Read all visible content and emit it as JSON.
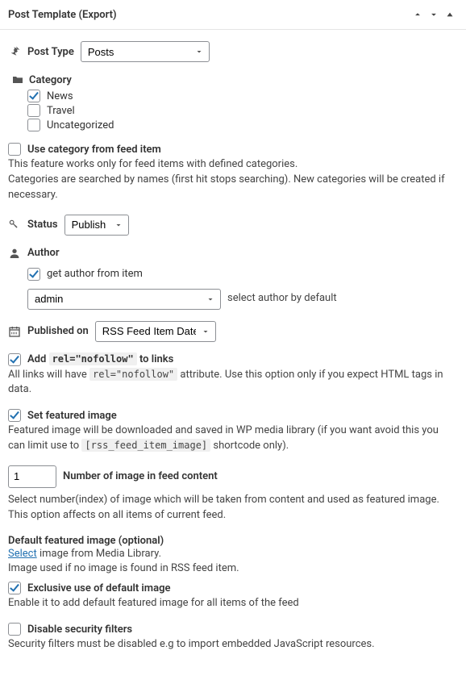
{
  "header": {
    "title": "Post Template (Export)"
  },
  "postType": {
    "label": "Post Type",
    "value": "Posts"
  },
  "category": {
    "label": "Category",
    "items": [
      {
        "label": "News",
        "checked": true
      },
      {
        "label": "Travel",
        "checked": false
      },
      {
        "label": "Uncategorized",
        "checked": false
      }
    ]
  },
  "useCatFromFeed": {
    "label": "Use category from feed item",
    "checked": false,
    "desc1": "This feature works only for feed items with defined categories.",
    "desc2": "Categories are searched by names (first hit stops searching). New categories will be created if necessary."
  },
  "status": {
    "label": "Status",
    "value": "Publish"
  },
  "author": {
    "label": "Author",
    "getFromItem": {
      "label": "get author from item",
      "checked": true
    },
    "value": "admin",
    "defaultHint": "select author by default"
  },
  "publishedOn": {
    "label": "Published on",
    "value": "RSS Feed Item Date"
  },
  "nofollow": {
    "checked": true,
    "pre": "Add",
    "code": "rel=\"nofollow\"",
    "post": "to links",
    "descPre": "All links will have",
    "descCode": "rel=\"nofollow\"",
    "descPost": "attribute. Use this option only if you expect HTML tags in data."
  },
  "featured": {
    "checked": true,
    "label": "Set featured image",
    "descPre": "Featured image will be downloaded and saved in WP media library (if you want avoid this you can limit use to",
    "descCode": "[rss_feed_item_image]",
    "descPost": "shortcode only)."
  },
  "imageNumber": {
    "value": "1",
    "label": "Number of image in feed content",
    "desc": "Select number(index) of image which will be taken from content and used as featured image. This option affects on all items of current feed."
  },
  "defaultImage": {
    "title": "Default featured image (optional)",
    "selectLink": "Select",
    "selectRest": "image from Media Library.",
    "desc": "Image used if no image is found in RSS feed item."
  },
  "exclusive": {
    "checked": true,
    "label": "Exclusive use of default image",
    "desc": "Enable it to add default featured image for all items of the feed"
  },
  "security": {
    "checked": false,
    "label": "Disable security filters",
    "desc": "Security filters must be disabled e.g to import embedded JavaScript resources."
  }
}
